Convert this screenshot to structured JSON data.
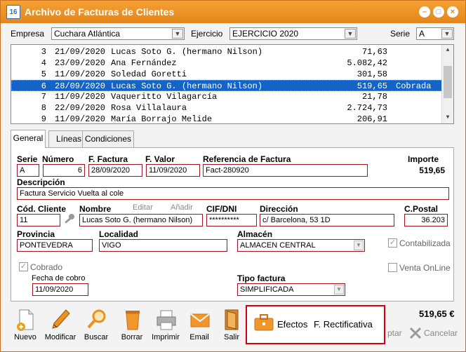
{
  "window": {
    "title": "Archivo de Facturas de Clientes",
    "app_icon": "16",
    "minimize": "–",
    "maximize": "□",
    "close": "×"
  },
  "filters": {
    "empresa_label": "Empresa",
    "empresa_value": "Cuchara Atlántica",
    "ejercicio_label": "Ejercicio",
    "ejercicio_value": "EJERCICIO 2020",
    "serie_label": "Serie",
    "serie_value": "A"
  },
  "list": {
    "rows": [
      {
        "num": "3",
        "date": "21/09/2020",
        "name": "Lucas Soto G. (hermano Nilson)",
        "amount": "71,63",
        "status": ""
      },
      {
        "num": "4",
        "date": "23/09/2020",
        "name": "Ana Fernández",
        "amount": "5.082,42",
        "status": ""
      },
      {
        "num": "5",
        "date": "11/09/2020",
        "name": "Soledad Goretti",
        "amount": "301,58",
        "status": ""
      },
      {
        "num": "6",
        "date": "28/09/2020",
        "name": "Lucas Soto G. (hermano Nilson)",
        "amount": "519,65",
        "status": "Cobrada"
      },
      {
        "num": "7",
        "date": "11/09/2020",
        "name": "Vaqueritto Vilagarcía",
        "amount": "21,78",
        "status": ""
      },
      {
        "num": "8",
        "date": "22/09/2020",
        "name": "Rosa Villalaura",
        "amount": "2.724,73",
        "status": ""
      },
      {
        "num": "9",
        "date": "11/09/2020",
        "name": "María Borrajo Melide",
        "amount": "206,91",
        "status": ""
      }
    ]
  },
  "tabs": [
    "General",
    "Líneas",
    "Condiciones"
  ],
  "form": {
    "serie_label": "Serie",
    "serie": "A",
    "numero_label": "Número",
    "numero": "6",
    "ffactura_label": "F. Factura",
    "ffactura": "28/09/2020",
    "fvalor_label": "F. Valor",
    "fvalor": "11/09/2020",
    "referencia_label": "Referencia de Factura",
    "referencia": "Fact-280920",
    "importe_label": "Importe",
    "importe": "519,65",
    "descripcion_label": "Descripción",
    "descripcion": "Factura Servicio Vuelta al cole",
    "codcliente_label": "Cód. Cliente",
    "codcliente": "11",
    "nombre_label": "Nombre",
    "editar": "Editar",
    "anadir": "Añadir",
    "nombre": "Lucas Soto G. (hermano Nilson)",
    "cif_label": "CIF/DNI",
    "cif": "**********",
    "direccion_label": "Dirección",
    "direccion": "c/ Barcelona, 53 1D",
    "cpostal_label": "C.Postal",
    "cpostal": "36.203",
    "provincia_label": "Provincia",
    "provincia": "PONTEVEDRA",
    "localidad_label": "Localidad",
    "localidad": "VIGO",
    "almacen_label": "Almacén",
    "almacen": "ALMACEN CENTRAL",
    "contabilizada_label": "Contabilizada",
    "cobrado_label": "Cobrado",
    "fechacobro_label": "Fecha de cobro",
    "fechacobro": "11/09/2020",
    "tipofactura_label": "Tipo factura",
    "tipofactura": "SIMPLIFICADA",
    "ventaonline_label": "Venta OnLine"
  },
  "toolbar": {
    "nuevo": "Nuevo",
    "modificar": "Modificar",
    "buscar": "Buscar",
    "borrar": "Borrar",
    "imprimir": "Imprimir",
    "email": "Email",
    "salir": "Salir",
    "efectos": "Efectos",
    "frectificativa": "F. Rectificativa",
    "aceptar": "ptar",
    "cancelar": "Cancelar",
    "total": "519,65 €"
  },
  "colors": {
    "title_bar": "#e2861c",
    "selection": "#1464c8",
    "field_border": "#a4141e",
    "highlight": "#d8000f"
  }
}
